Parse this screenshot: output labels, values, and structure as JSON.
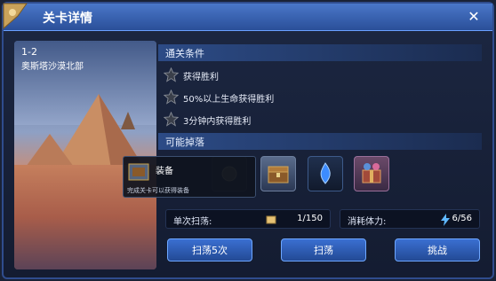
{
  "window": {
    "title": "关卡详情",
    "close_label": "✕"
  },
  "stage": {
    "number": "1-2",
    "name": "奥斯塔沙漠北部"
  },
  "conditions": {
    "header": "通关条件",
    "items": [
      "获得胜利",
      "50%以上生命获得胜利",
      "3分钟内获得胜利"
    ]
  },
  "drops": {
    "header": "可能掉落",
    "tooltip": {
      "title": "装备",
      "description": "完成关卡可以获得装备"
    }
  },
  "stats": {
    "sweep_label": "单次扫荡:",
    "sweep_value": "1/150",
    "stamina_label": "消耗体力:",
    "stamina_value": "6/56"
  },
  "buttons": {
    "sweep5": "扫荡5次",
    "sweep": "扫荡",
    "challenge": "挑战"
  },
  "colors": {
    "accent": "#2f4c8d",
    "button": "#3a6fd1"
  }
}
